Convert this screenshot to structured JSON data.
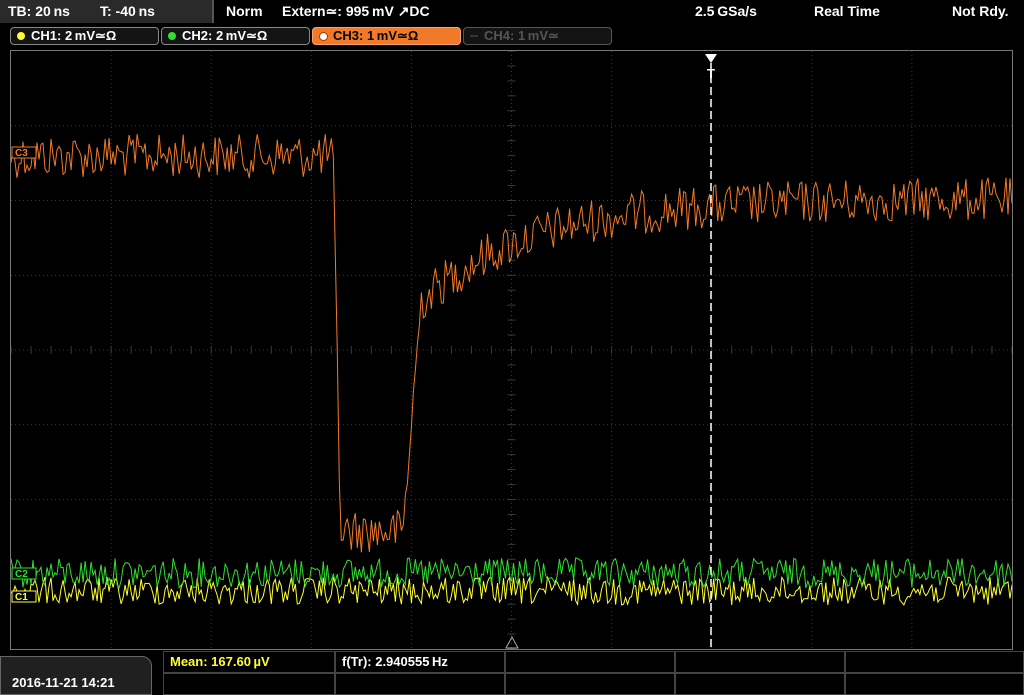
{
  "status": {
    "timebase": "TB: 20 ns",
    "trigger_time": "T: -40 ns",
    "mode": "Norm",
    "trigger_source": "Extern≃: 995 mV ↗DC",
    "sample_rate": "2.5 GSa/s",
    "acquisition": "Real Time",
    "state": "Not Rdy."
  },
  "channels": [
    {
      "label": "CH1: 2 mV≃Ω",
      "color": "#ffff30",
      "active": false,
      "enabled": true
    },
    {
      "label": "CH2: 2 mV≃Ω",
      "color": "#30e030",
      "active": false,
      "enabled": true
    },
    {
      "label": "CH3: 1 mV≃Ω",
      "color": "#f07a2a",
      "active": true,
      "enabled": true
    },
    {
      "label": "CH4: 1 mV≃",
      "color": "#555555",
      "active": false,
      "enabled": false
    }
  ],
  "markers": {
    "trigger_label": "T",
    "ch3_label": "C3",
    "ch2_label": "C2",
    "ch1_label": "C1"
  },
  "measurements": {
    "mean": "Mean: 167.60 µV",
    "frequency": "f(Tr): 2.940555 Hz"
  },
  "datetime": "2016-11-21 14:21",
  "colors": {
    "grid": "#3a3a3a",
    "ch1": "#ffff30",
    "ch2": "#30e030",
    "ch3": "#f07a2a"
  }
}
